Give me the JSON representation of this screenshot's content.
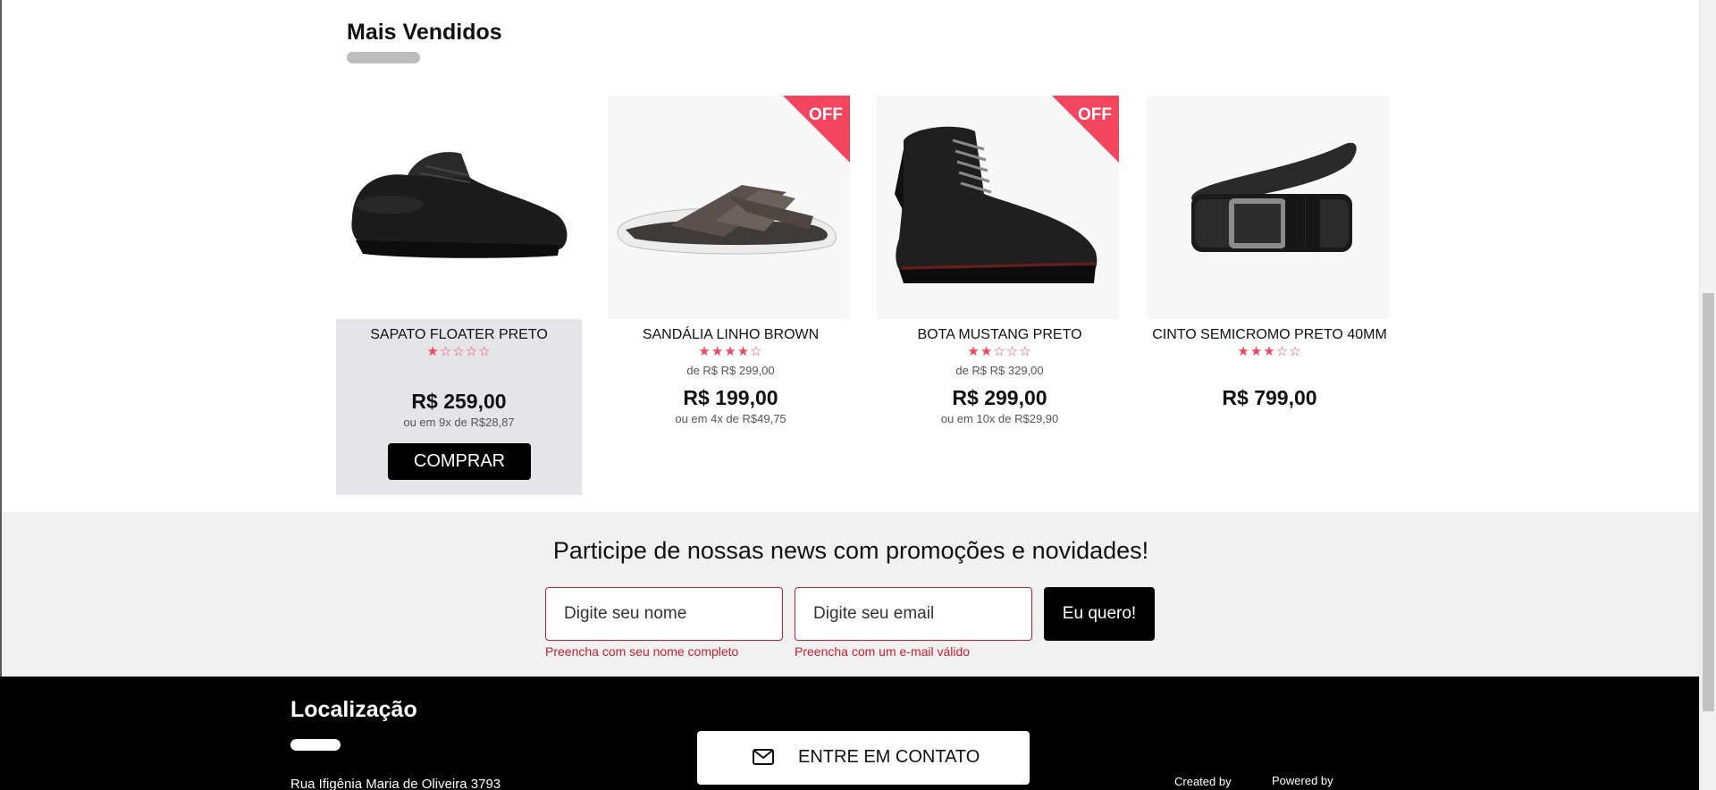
{
  "section": {
    "title": "Mais Vendidos"
  },
  "products": [
    {
      "name": "SAPATO FLOATER PRETO",
      "rating": 1,
      "stars": "★☆☆☆☆",
      "old_price": "",
      "price": "R$ 259,00",
      "installments": "ou em 9x de R$28,87",
      "badge": "",
      "buy_label": "COMPRAR",
      "icon": "shoe-image"
    },
    {
      "name": "SANDÁLIA LINHO BROWN",
      "rating": 4,
      "stars": "★★★★☆",
      "old_price": "de R$ R$ 299,00",
      "price": "R$ 199,00",
      "installments": "ou em 4x de R$49,75",
      "badge": "OFF",
      "icon": "sandal-image"
    },
    {
      "name": "BOTA MUSTANG PRETO",
      "rating": 2,
      "stars": "★★☆☆☆",
      "old_price": "de R$ R$ 329,00",
      "price": "R$ 299,00",
      "installments": "ou em 10x de R$29,90",
      "badge": "OFF",
      "icon": "boot-image"
    },
    {
      "name": "CINTO SEMICROMO PRETO 40MM",
      "rating": 3,
      "stars": "★★★☆☆",
      "old_price": "",
      "price": "R$ 799,00",
      "installments": "",
      "badge": "",
      "icon": "belt-image"
    }
  ],
  "newsletter": {
    "title": "Participe de nossas news com promoções e novidades!",
    "name_placeholder": "Digite seu nome",
    "email_placeholder": "Digite seu email",
    "name_error": "Preencha com seu nome completo",
    "email_error": "Preencha com um e-mail válido",
    "submit_label": "Eu quero!"
  },
  "footer": {
    "location_title": "Localização",
    "address": "Rua Ifigênia Maria de Oliveira 3793",
    "contact_label": "ENTRE EM CONTATO",
    "created_by": "Created by",
    "powered_by": "Powered by"
  },
  "colors": {
    "accent": "#f3455d",
    "error": "#c8202f",
    "footer_bg": "#000000",
    "newsletter_bg": "#f1f1f1"
  }
}
